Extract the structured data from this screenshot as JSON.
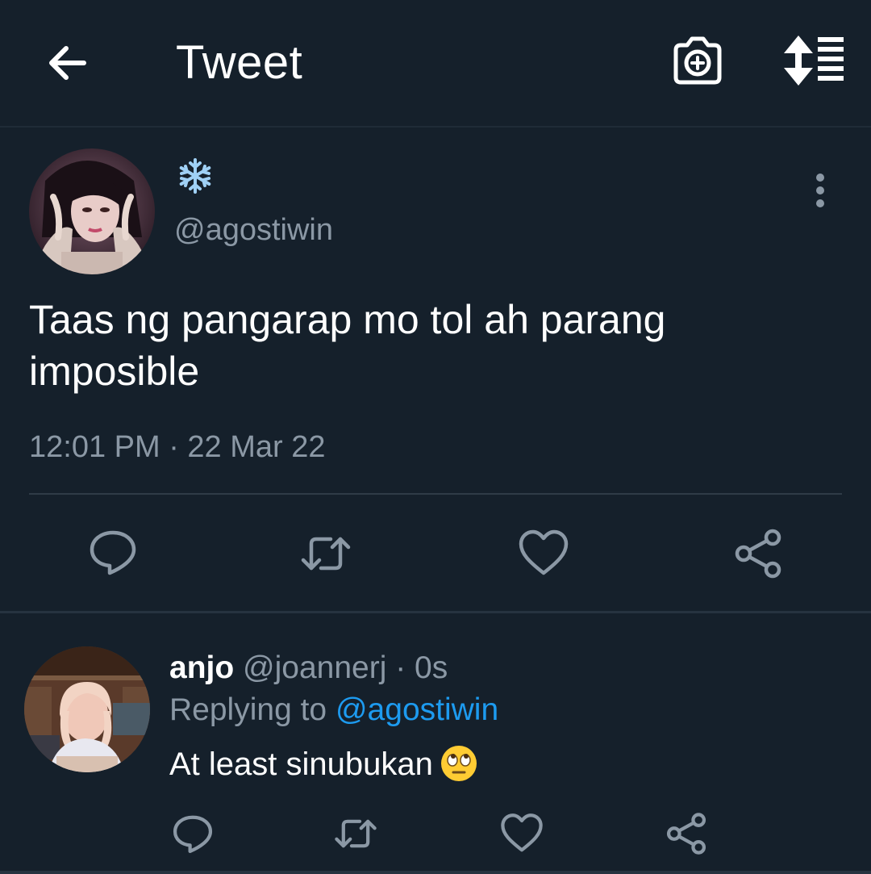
{
  "header": {
    "title": "Tweet",
    "back_icon": "arrow-left-icon",
    "camera_icon": "camera-plus-icon",
    "sort_icon": "sort-icon"
  },
  "main_tweet": {
    "display_name": "❄️",
    "handle": "@agostiwin",
    "text": "Taas ng pangarap mo tol ah parang imposible",
    "timestamp": "12:01 PM · 22 Mar 22",
    "actions": [
      "reply-icon",
      "retweet-icon",
      "like-icon",
      "share-icon"
    ]
  },
  "reply": {
    "name": "anjo",
    "handle": "@joannerj",
    "time": "· 0s",
    "replying_prefix": "Replying to",
    "replying_to": "@agostiwin",
    "text": "At least sinubukan",
    "emoji": "🙄",
    "actions": [
      "reply-icon",
      "retweet-icon",
      "like-icon",
      "share-icon"
    ]
  },
  "colors": {
    "background": "#15202b",
    "text_primary": "#ffffff",
    "text_secondary": "#8b98a5",
    "accent": "#1d9bf0",
    "divider": "#2f3b47"
  }
}
